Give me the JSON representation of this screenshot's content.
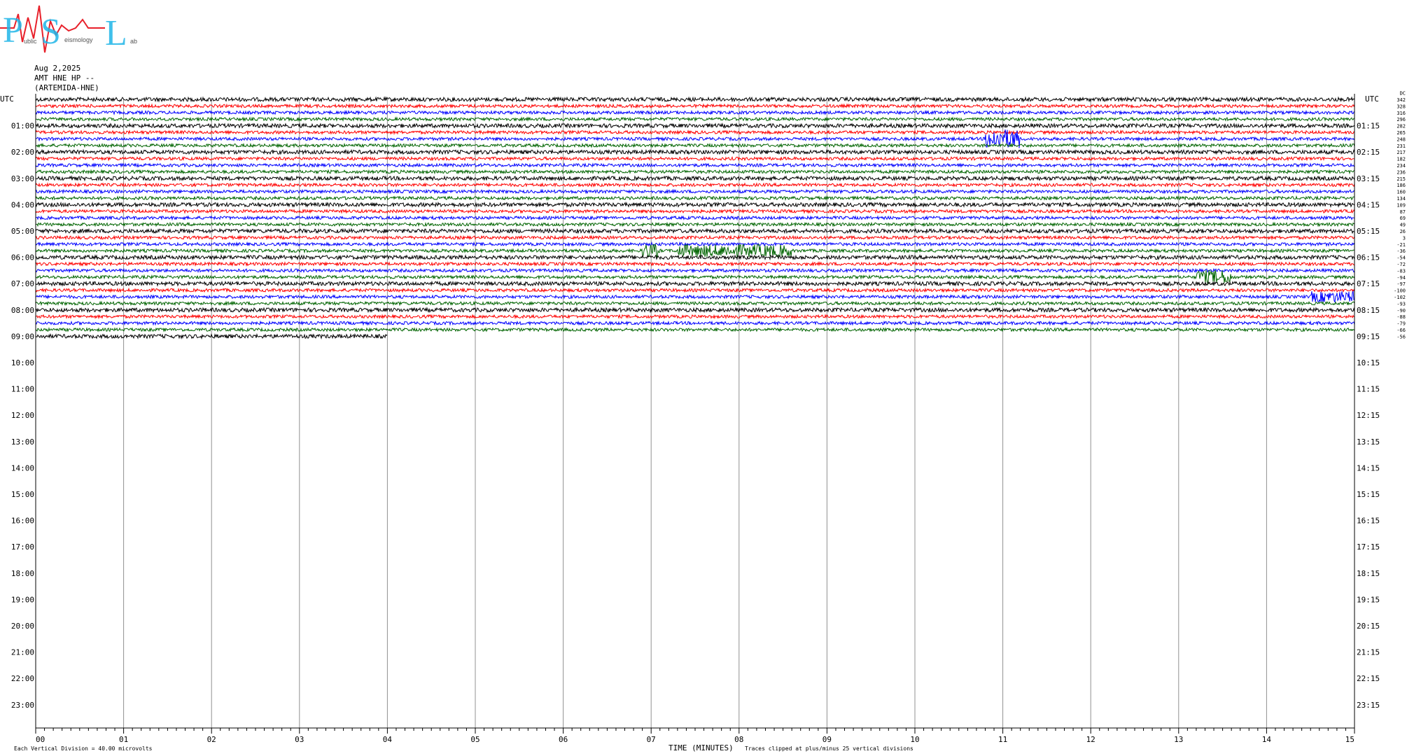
{
  "logo": {
    "letters": [
      "P",
      "S",
      "L"
    ],
    "small_text": [
      "ublic",
      "eismology",
      "ab"
    ],
    "colors": {
      "letters": "#1fb6e8",
      "seismo": "#e8202a"
    }
  },
  "header": {
    "date": "Aug 2,2025",
    "station": "AMT HNE HP --",
    "name": "(ARTEMIDA-HNE)"
  },
  "chart_data": {
    "type": "line",
    "title": "",
    "xlabel": "TIME (MINUTES)",
    "ylabel": "",
    "x_ticks": [
      "00",
      "01",
      "02",
      "03",
      "04",
      "05",
      "06",
      "07",
      "08",
      "09",
      "10",
      "11",
      "12",
      "13",
      "14",
      "15"
    ],
    "xlim": [
      0,
      15
    ],
    "left_label_top": "UTC",
    "right_label_top": "UTC",
    "left_hours": [
      "01:00",
      "02:00",
      "03:00",
      "04:00",
      "05:00",
      "06:00",
      "07:00",
      "08:00",
      "09:00",
      "10:00",
      "11:00",
      "12:00",
      "13:00",
      "14:00",
      "15:00",
      "16:00",
      "17:00",
      "18:00",
      "19:00",
      "20:00",
      "21:00",
      "22:00",
      "23:00"
    ],
    "right_hours": [
      "01:15",
      "02:15",
      "03:15",
      "04:15",
      "05:15",
      "06:15",
      "07:15",
      "08:15",
      "09:15",
      "10:15",
      "11:15",
      "12:15",
      "13:15",
      "14:15",
      "15:15",
      "16:15",
      "17:15",
      "18:15",
      "19:15",
      "20:15",
      "21:15",
      "22:15",
      "23:15"
    ],
    "trace_colors": [
      "#000000",
      "#ff0000",
      "#0000ff",
      "#006400"
    ],
    "trace_rows_per_hour": 4,
    "trace_count": 37,
    "last_trace_end_minute": 4,
    "offsets": [
      "DC",
      "342",
      "328",
      "316",
      "296",
      "282",
      "265",
      "248",
      "231",
      "217",
      "182",
      "234",
      "236",
      "215",
      "186",
      "160",
      "134",
      "109",
      "87",
      "69",
      "49",
      "26",
      "3",
      "-21",
      "-36",
      "-54",
      "-72",
      "-83",
      "-94",
      "-97",
      "-100",
      "-102",
      "-93",
      "-90",
      "-88",
      "-79",
      "-66",
      "-56"
    ],
    "footer_left": "Each Vertical Division =   40.00 microvolts",
    "footer_right": "Traces clipped at plus/minus 25 vertical divisions",
    "grid": true
  }
}
